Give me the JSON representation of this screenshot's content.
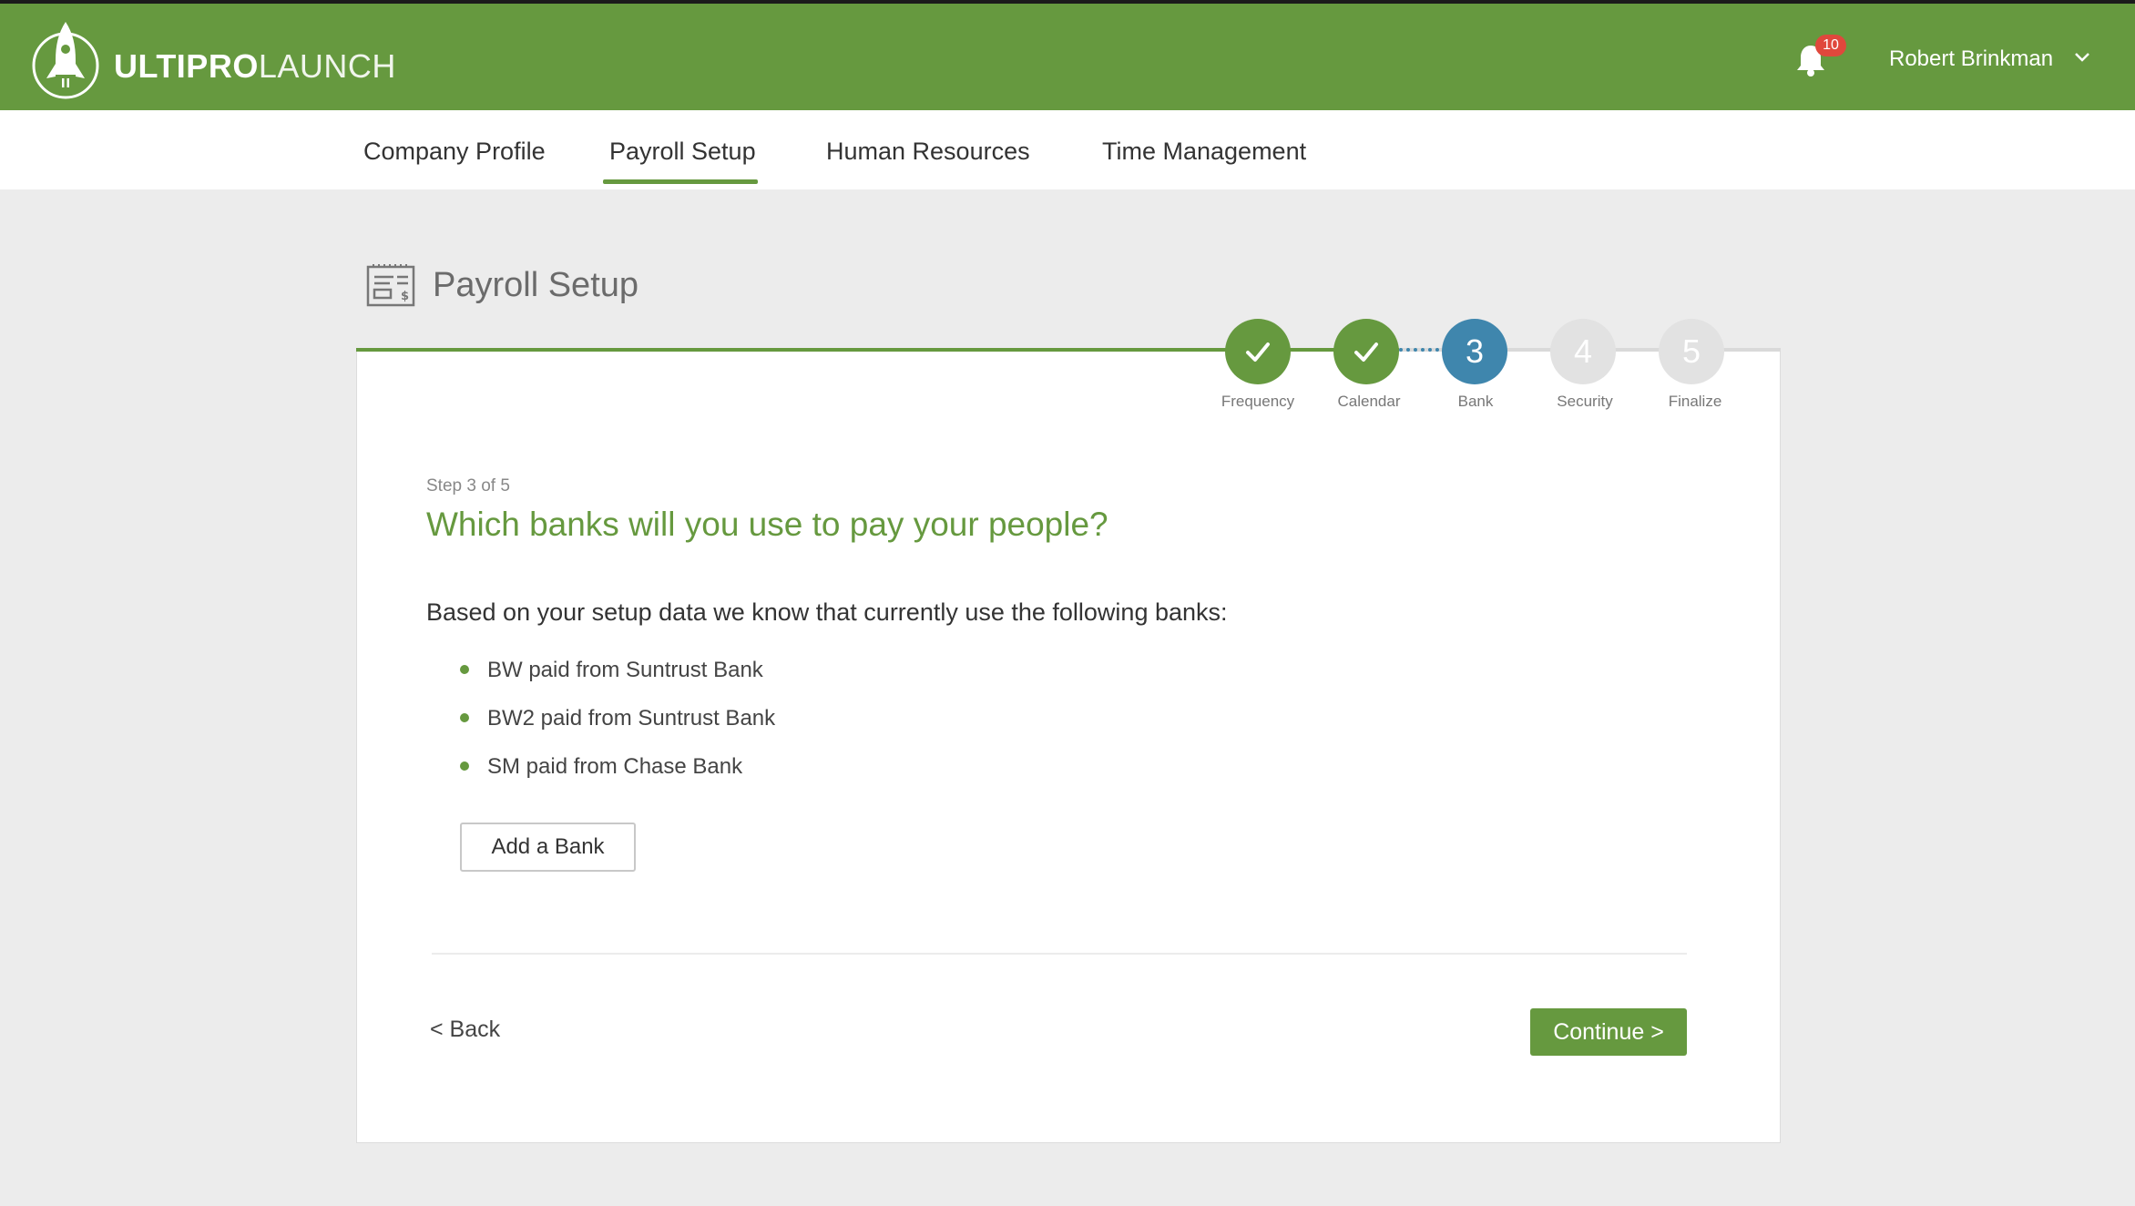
{
  "header": {
    "brand_bold": "ULTIPRO",
    "brand_light": "LAUNCH",
    "notification_count": "10",
    "user_name": "Robert Brinkman",
    "brand_color": "#66993f"
  },
  "nav": {
    "tabs": [
      {
        "label": "Company Profile"
      },
      {
        "label": "Payroll Setup",
        "active": true
      },
      {
        "label": "Human Resources"
      },
      {
        "label": "Time Management"
      }
    ]
  },
  "page": {
    "title": "Payroll Setup"
  },
  "stepper": {
    "steps": [
      {
        "number": "1",
        "label": "Frequency",
        "status": "done"
      },
      {
        "number": "2",
        "label": "Calendar",
        "status": "done"
      },
      {
        "number": "3",
        "label": "Bank",
        "status": "current"
      },
      {
        "number": "4",
        "label": "Security",
        "status": "pending"
      },
      {
        "number": "5",
        "label": "Finalize",
        "status": "pending"
      }
    ],
    "current_color": "#3f86ad"
  },
  "content": {
    "step_count": "Step 3 of 5",
    "question": "Which banks will you use to pay your people?",
    "intro": "Based on your setup data we know that currently use the following banks:",
    "banks": [
      "BW paid from Suntrust Bank",
      "BW2 paid from Suntrust Bank",
      "SM paid from Chase Bank"
    ],
    "add_bank_label": "Add a Bank"
  },
  "footer": {
    "back_label": "< Back",
    "continue_label": "Continue >"
  }
}
